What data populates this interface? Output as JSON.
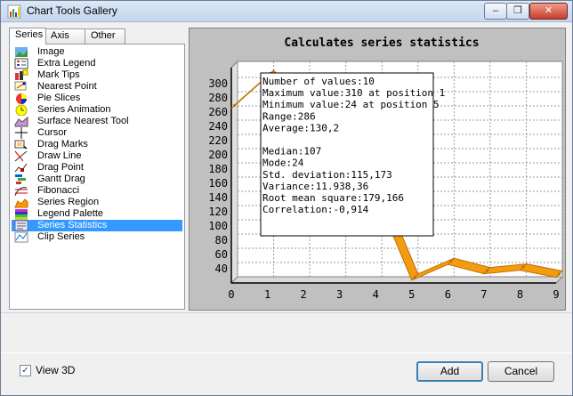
{
  "window": {
    "title": "Chart Tools Gallery",
    "minimize_symbol": "–",
    "restore_symbol": "❐",
    "close_symbol": "✕"
  },
  "tabs": [
    {
      "label": "Series",
      "active": true
    },
    {
      "label": "Axis",
      "active": false
    },
    {
      "label": "Other",
      "active": false
    }
  ],
  "tools": [
    {
      "label": "Image",
      "icon": "image-icon"
    },
    {
      "label": "Extra Legend",
      "icon": "extra-legend-icon"
    },
    {
      "label": "Mark Tips",
      "icon": "mark-tips-icon"
    },
    {
      "label": "Nearest Point",
      "icon": "nearest-point-icon"
    },
    {
      "label": "Pie Slices",
      "icon": "pie-slices-icon"
    },
    {
      "label": "Series Animation",
      "icon": "series-animation-icon"
    },
    {
      "label": "Surface Nearest Tool",
      "icon": "surface-nearest-icon"
    },
    {
      "label": "Cursor",
      "icon": "cursor-icon"
    },
    {
      "label": "Drag Marks",
      "icon": "drag-marks-icon"
    },
    {
      "label": "Draw Line",
      "icon": "draw-line-icon"
    },
    {
      "label": "Drag Point",
      "icon": "drag-point-icon"
    },
    {
      "label": "Gantt Drag",
      "icon": "gantt-drag-icon"
    },
    {
      "label": "Fibonacci",
      "icon": "fibonacci-icon"
    },
    {
      "label": "Series Region",
      "icon": "series-region-icon"
    },
    {
      "label": "Legend Palette",
      "icon": "legend-palette-icon"
    },
    {
      "label": "Series Statistics",
      "icon": "series-statistics-icon",
      "selected": true
    },
    {
      "label": "Clip Series",
      "icon": "clip-series-icon"
    }
  ],
  "chart": {
    "title": "Calculates series statistics",
    "stats_lines": [
      "Number of values:10",
      "Maximum value:310 at position 1",
      "Minimum value:24 at position 5",
      "Range:286",
      "Average:130,2",
      "",
      "Median:107",
      "Mode:24",
      "Std. deviation:115,173",
      "Variance:11.938,36",
      "Root mean square:179,166",
      "Correlation:-0,914"
    ]
  },
  "chart_data": {
    "type": "line",
    "title": "Calculates series statistics",
    "x": [
      0,
      1,
      2,
      3,
      4,
      5,
      6,
      7,
      8,
      9
    ],
    "values": [
      265,
      310,
      255,
      205,
      145,
      24,
      46,
      33,
      38,
      28
    ],
    "xlim": [
      0,
      9
    ],
    "ylim": [
      20,
      310
    ],
    "y_ticks": [
      40,
      60,
      80,
      100,
      120,
      140,
      160,
      180,
      200,
      220,
      240,
      260,
      280,
      300
    ],
    "x_ticks": [
      0,
      1,
      2,
      3,
      4,
      5,
      6,
      7,
      8,
      9
    ],
    "grid": true,
    "three_d": true,
    "line_color": "#f39c12",
    "line_side_color": "#c07000"
  },
  "footer": {
    "view3d_label": "View 3D",
    "view3d_checked": true,
    "check_mark": "✓",
    "add_label": "Add",
    "cancel_label": "Cancel"
  }
}
